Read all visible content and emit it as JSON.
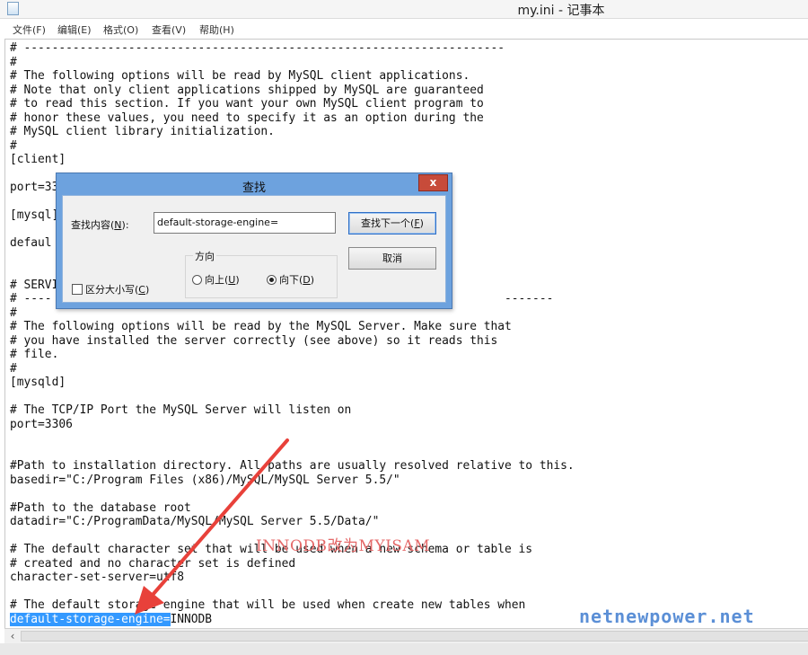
{
  "window": {
    "title": "my.ini - 记事本"
  },
  "menu": [
    "文件(F)",
    "编辑(E)",
    "格式(O)",
    "查看(V)",
    "帮助(H)"
  ],
  "editor": {
    "lines": [
      "# ---------------------------------------------------------------------",
      "#",
      "# The following options will be read by MySQL client applications.",
      "# Note that only client applications shipped by MySQL are guaranteed",
      "# to read this section. If you want your own MySQL client program to",
      "# honor these values, you need to specify it as an option during the",
      "# MySQL client library initialization.",
      "#",
      "[client]",
      "",
      "port=33",
      "",
      "[mysql]",
      "",
      "defaul",
      "",
      "",
      "# SERVI",
      "# ----                                                                 -------",
      "#",
      "# The following options will be read by the MySQL Server. Make sure that",
      "# you have installed the server correctly (see above) so it reads this",
      "# file.",
      "#",
      "[mysqld]",
      "",
      "# The TCP/IP Port the MySQL Server will listen on",
      "port=3306",
      "",
      "",
      "#Path to installation directory. All paths are usually resolved relative to this.",
      "basedir=\"C:/Program Files (x86)/MySQL/MySQL Server 5.5/\"",
      "",
      "#Path to the database root",
      "datadir=\"C:/ProgramData/MySQL/MySQL Server 5.5/Data/\"",
      "",
      "# The default character set that will be used when a new schema or table is",
      "# created and no character set is defined",
      "character-set-server=utf8",
      "",
      "# The default storage engine that will be used when create new tables when"
    ],
    "last_line_selected": "default-storage-engine=",
    "last_line_rest": "INNODB"
  },
  "dialog": {
    "title": "查找",
    "close": "x",
    "find_label_pre": "查找内容(",
    "find_label_key": "N",
    "find_label_post": "):",
    "find_value": "default-storage-engine=",
    "find_next_pre": "查找下一个(",
    "find_next_key": "F",
    "find_next_post": ")",
    "cancel": "取消",
    "direction_title": "方向",
    "up_pre": "向上(",
    "up_key": "U",
    "up_post": ")",
    "down_pre": "向下(",
    "down_key": "D",
    "down_post": ")",
    "direction_selected": "down",
    "case_pre": "区分大小写(",
    "case_key": "C",
    "case_post": ")",
    "case_checked": false
  },
  "annotation": {
    "text": "INNODB改为MYISAM",
    "color": "#e8413a"
  },
  "watermark": "netnewpower.net"
}
